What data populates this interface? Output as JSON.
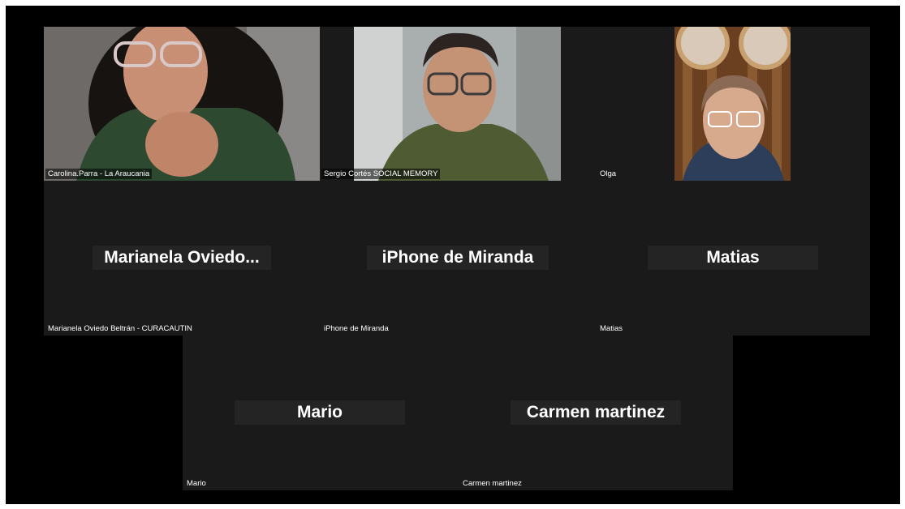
{
  "meeting": {
    "participants": [
      {
        "display_name": "",
        "label": "Carolina.Parra - La Araucania",
        "video": "on"
      },
      {
        "display_name": "",
        "label": "Sergio Cortés SOCIAL MEMORY",
        "video": "on"
      },
      {
        "display_name": "",
        "label": "Olga",
        "video": "on"
      },
      {
        "display_name": "Marianela  Oviedo...",
        "label": "Marianela Oviedo Beltrán - CURACAUTIN",
        "video": "off"
      },
      {
        "display_name": "iPhone de Miranda",
        "label": "iPhone de Miranda",
        "video": "off"
      },
      {
        "display_name": "Matias",
        "label": "Matias",
        "video": "off"
      },
      {
        "display_name": "Mario",
        "label": "Mario",
        "video": "off"
      },
      {
        "display_name": "Carmen martinez",
        "label": "Carmen martinez",
        "video": "off"
      }
    ]
  },
  "colors": {
    "stage_background": "#000000",
    "tile_background": "#1a1a1a",
    "name_banner_background": "#242424",
    "text": "#ffffff"
  }
}
